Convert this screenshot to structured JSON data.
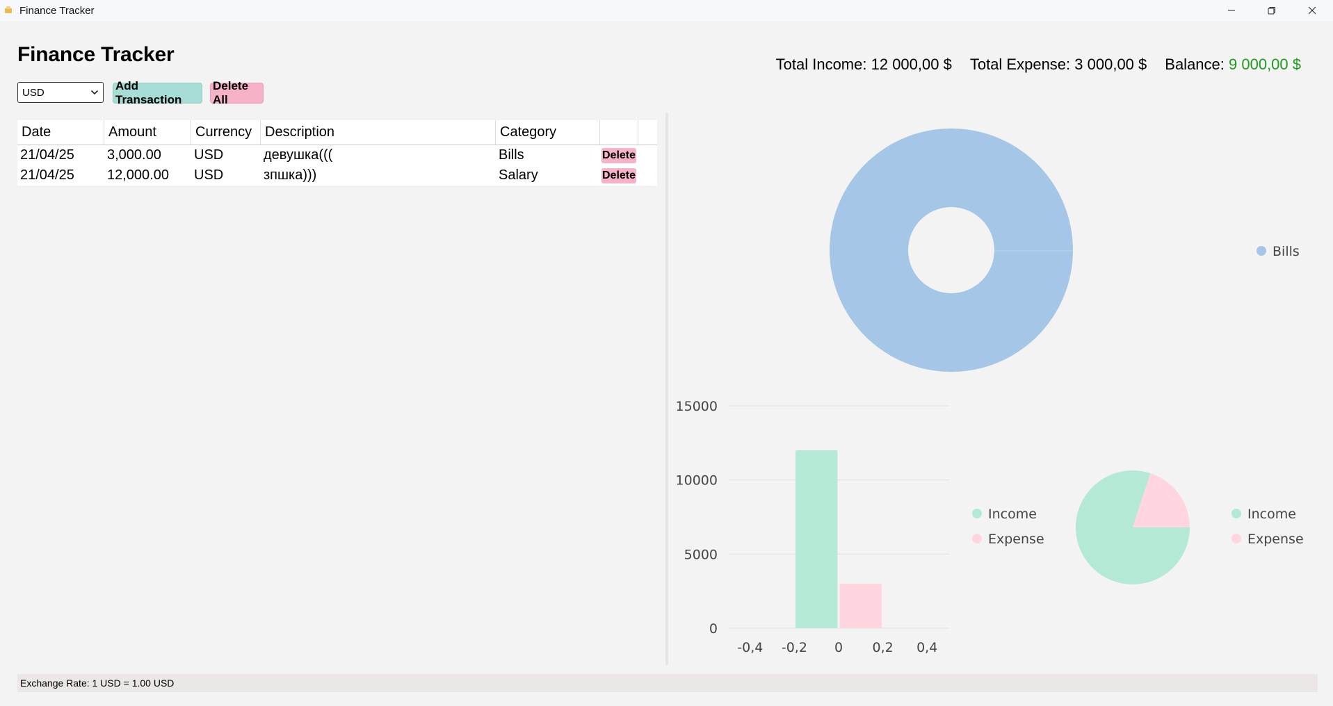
{
  "window": {
    "title": "Finance Tracker",
    "controls": [
      "minimize-icon",
      "restore-icon",
      "close-icon"
    ]
  },
  "header": {
    "title": "Finance Tracker",
    "total_income_label": "Total Income:",
    "total_income_value": "12 000,00 $",
    "total_expense_label": "Total Expense:",
    "total_expense_value": "3 000,00 $",
    "balance_label": "Balance:",
    "balance_value": "9 000,00 $",
    "balance_color": "#1f9a1f"
  },
  "toolbar": {
    "currency_selected": "USD",
    "add_label": "Add Transaction",
    "delete_all_label": "Delete All"
  },
  "table": {
    "columns": [
      "Date",
      "Amount",
      "Currency",
      "Description",
      "Category"
    ],
    "rows": [
      {
        "date": "21/04/25",
        "amount": "3,000.00",
        "currency": "USD",
        "description": "девушка(((",
        "category": "Bills",
        "action": "Delete"
      },
      {
        "date": "21/04/25",
        "amount": "12,000.00",
        "currency": "USD",
        "description": "зпшка)))",
        "category": "Salary",
        "action": "Delete"
      }
    ]
  },
  "colors": {
    "income": "#b3e9d5",
    "expense": "#ffd6df",
    "bills": "#a6c6e7",
    "add_button": "#a7ddd6",
    "delete_button": "#f6b3c8"
  },
  "chart_data": [
    {
      "type": "pie",
      "variant": "donut",
      "labels": [
        "Bills"
      ],
      "values": [
        3000
      ],
      "legend": [
        "Bills"
      ],
      "legend_position": "right"
    },
    {
      "type": "bar",
      "series": [
        {
          "name": "Income",
          "x": -0.1,
          "value": 12000
        },
        {
          "name": "Expense",
          "x": 0.1,
          "value": 3000
        }
      ],
      "xlim": [
        -0.5,
        0.5
      ],
      "xticks": [
        "-0,4",
        "-0,2",
        "0",
        "0,2",
        "0,4"
      ],
      "ylim": [
        0,
        15000
      ],
      "yticks": [
        "0",
        "5000",
        "10000",
        "15000"
      ],
      "grid": true,
      "legend": [
        "Income",
        "Expense"
      ],
      "legend_position": "right"
    },
    {
      "type": "pie",
      "labels": [
        "Income",
        "Expense"
      ],
      "values": [
        12000,
        3000
      ],
      "legend": [
        "Income",
        "Expense"
      ],
      "legend_position": "right"
    }
  ],
  "status": {
    "exchange_rate": "Exchange Rate: 1 USD = 1.00 USD"
  }
}
